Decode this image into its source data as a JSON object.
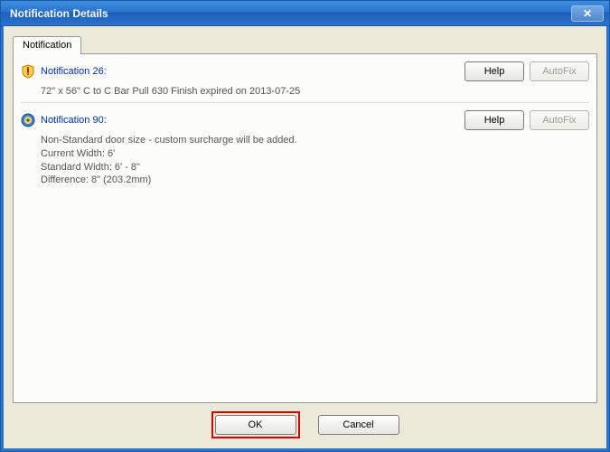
{
  "window": {
    "title": "Notification Details"
  },
  "tab": {
    "label": "Notification"
  },
  "notifications": [
    {
      "icon": "shield",
      "title": "Notification 26:",
      "body": "72\" x 56\" C to C Bar Pull 630 Finish expired on 2013-07-25",
      "help_label": "Help",
      "autofix_label": "AutoFix",
      "autofix_enabled": false
    },
    {
      "icon": "circle",
      "title": "Notification 90:",
      "body": "Non-Standard door size - custom surcharge will be added.\nCurrent Width: 6'\nStandard Width: 6' - 8\"\nDifference: 8\" (203.2mm)",
      "help_label": "Help",
      "autofix_label": "AutoFix",
      "autofix_enabled": false
    }
  ],
  "footer": {
    "ok_label": "OK",
    "cancel_label": "Cancel"
  }
}
